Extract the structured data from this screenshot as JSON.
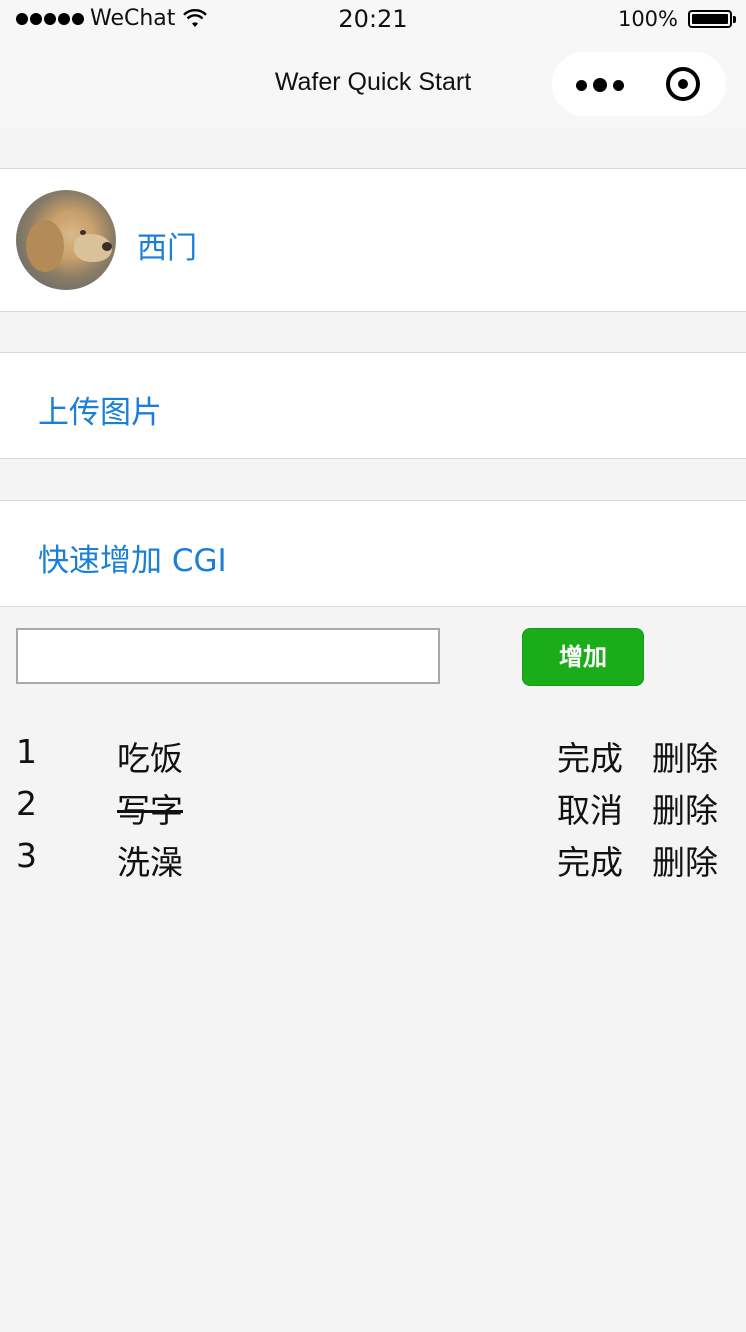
{
  "status_bar": {
    "carrier": "WeChat",
    "time": "20:21",
    "battery": "100%",
    "icons": [
      "signal-dots-icon",
      "wifi-icon",
      "battery-icon"
    ]
  },
  "nav": {
    "title": "Wafer Quick Start",
    "capsule_icons": [
      "more-icon",
      "close-target-icon"
    ]
  },
  "user": {
    "name": "西门",
    "avatar": "dog-avatar"
  },
  "upload": {
    "label": "上传图片"
  },
  "cgi": {
    "label": "快速增加 CGI"
  },
  "todo_form": {
    "input_value": "",
    "add_label": "增加"
  },
  "todos": [
    {
      "index": "1",
      "text": "吃饭",
      "done": false,
      "toggle_label": "完成",
      "delete_label": "删除"
    },
    {
      "index": "2",
      "text": "写字",
      "done": true,
      "toggle_label": "取消",
      "delete_label": "删除"
    },
    {
      "index": "3",
      "text": "洗澡",
      "done": false,
      "toggle_label": "完成",
      "delete_label": "删除"
    }
  ],
  "colors": {
    "link": "#1a7fd6",
    "primary_button": "#1aad19",
    "background": "#f4f4f4"
  }
}
